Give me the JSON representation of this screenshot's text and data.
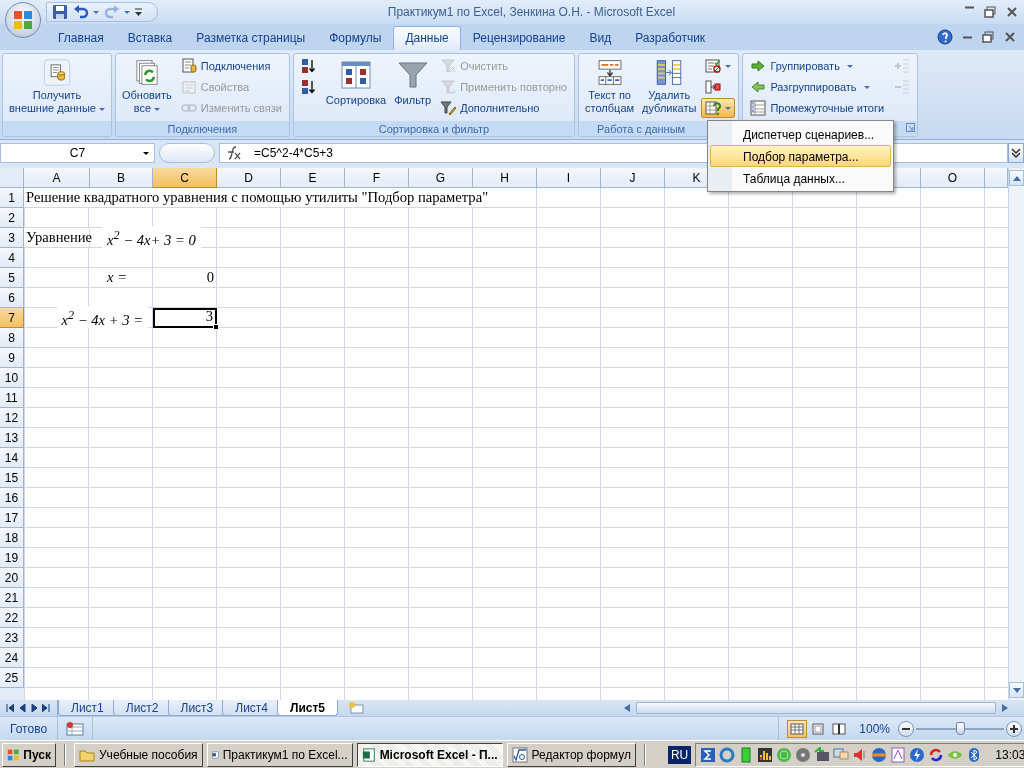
{
  "window": {
    "title": "Практикум1 по Excel, Зенкина О.Н. - Microsoft Excel",
    "quick_access": [
      {
        "disabled": false
      },
      {
        "disabled": false
      },
      {
        "disabled": true
      }
    ]
  },
  "tabs": [
    {
      "label": "Главная",
      "selected": false
    },
    {
      "label": "Вставка",
      "selected": false
    },
    {
      "label": "Разметка страницы",
      "selected": false
    },
    {
      "label": "Формулы",
      "selected": false
    },
    {
      "label": "Данные",
      "selected": true
    },
    {
      "label": "Рецензирование",
      "selected": false
    },
    {
      "label": "Вид",
      "selected": false
    },
    {
      "label": "Разработчик",
      "selected": false
    }
  ],
  "ribbon": {
    "groups": [
      {
        "columns": [
          [
            {
              "label": "Получить\nвнешние данные",
              "kind": "large",
              "dropdown": true,
              "disabled": false,
              "pressed": false
            }
          ]
        ],
        "launcher": false
      },
      {
        "label": "Подключения",
        "columns": [
          [
            {
              "label": "Обновить\nвсе",
              "kind": "large",
              "dropdown": true,
              "disabled": false,
              "pressed": false
            }
          ],
          [
            {
              "label": "Подключения",
              "kind": "small",
              "dropdown": false,
              "disabled": false,
              "pressed": false
            },
            {
              "label": "Свойства",
              "kind": "small",
              "dropdown": false,
              "disabled": true,
              "pressed": false
            },
            {
              "label": "Изменить связи",
              "kind": "small",
              "dropdown": false,
              "disabled": true,
              "pressed": false
            }
          ]
        ],
        "launcher": false
      },
      {
        "label": "Сортировка и фильтр",
        "columns": [
          [
            {
              "kind": "icon",
              "dropdown": false,
              "disabled": false,
              "pressed": false
            },
            {
              "kind": "icon",
              "dropdown": false,
              "disabled": false,
              "pressed": false
            }
          ],
          [
            {
              "label": "Сортировка",
              "kind": "large",
              "dropdown": false,
              "disabled": false,
              "pressed": false
            }
          ],
          [
            {
              "label": "Фильтр",
              "kind": "large",
              "dropdown": false,
              "disabled": false,
              "pressed": false
            }
          ],
          [
            {
              "label": "Очистить",
              "kind": "small",
              "dropdown": false,
              "disabled": true,
              "pressed": false
            },
            {
              "label": "Применить повторно",
              "kind": "small",
              "dropdown": false,
              "disabled": true,
              "pressed": false
            },
            {
              "label": "Дополнительно",
              "kind": "small",
              "dropdown": false,
              "disabled": false,
              "pressed": false
            }
          ]
        ],
        "launcher": false
      },
      {
        "label": "Работа с данным",
        "columns": [
          [
            {
              "label": "Текст по\nстолбцам",
              "kind": "large",
              "dropdown": false,
              "disabled": false,
              "pressed": false
            }
          ],
          [
            {
              "label": "Удалить\nдубликаты",
              "kind": "large",
              "dropdown": false,
              "disabled": false,
              "pressed": false
            }
          ],
          [
            {
              "kind": "icon",
              "dropdown": true,
              "disabled": false,
              "pressed": false
            },
            {
              "kind": "icon",
              "dropdown": false,
              "disabled": false,
              "pressed": false
            },
            {
              "kind": "icon",
              "dropdown": true,
              "disabled": false,
              "pressed": true
            }
          ]
        ],
        "launcher": false
      },
      {
        "columns": [
          [
            {
              "label": "Группировать",
              "kind": "small",
              "dropdown": true,
              "disabled": false,
              "pressed": false
            },
            {
              "label": "Разгруппировать",
              "kind": "small",
              "dropdown": true,
              "disabled": false,
              "pressed": false
            },
            {
              "label": "Промежуточные итоги",
              "kind": "small",
              "dropdown": false,
              "disabled": false,
              "pressed": false
            }
          ],
          [
            {
              "kind": "icon",
              "dropdown": false,
              "disabled": true,
              "pressed": false
            },
            {
              "kind": "icon",
              "dropdown": false,
              "disabled": true,
              "pressed": false
            }
          ]
        ],
        "launcher": true
      }
    ]
  },
  "menu": {
    "items": [
      {
        "label": "Диспетчер сценариев...",
        "selected": false
      },
      {
        "label": "Подбор параметра...",
        "selected": true
      },
      {
        "label": "Таблица данных...",
        "selected": false
      }
    ]
  },
  "formula_bar": {
    "name_box": "C7",
    "formula": "=C5^2-4*C5+3"
  },
  "sheet": {
    "columns": [
      {
        "label": "A"
      },
      {
        "label": "B"
      },
      {
        "label": "C"
      },
      {
        "label": "D"
      },
      {
        "label": "E"
      },
      {
        "label": "F"
      },
      {
        "label": "G"
      },
      {
        "label": "H"
      },
      {
        "label": "I"
      },
      {
        "label": "J"
      },
      {
        "label": "K"
      },
      null,
      null,
      {},
      {
        "label": "O"
      },
      {}
    ],
    "rows": [
      {
        "label": "1",
        "cells": [
          {
            "kind": "text",
            "text": "Решение квадратного уравнения с помощью утилиты \"Подбор параметра\"",
            "selected": false
          }
        ]
      },
      {
        "label": "2"
      },
      {
        "label": "3",
        "cells": [
          {
            "kind": "text",
            "text": "Уравнение",
            "selected": false
          },
          {
            "kind": "equation",
            "text": "x$^{2}$ − 4x+ 3 = 0",
            "selected": false
          }
        ]
      },
      {
        "label": "4"
      },
      {
        "label": "5",
        "cells": [
          {},
          {
            "kind": "equation",
            "text": "x  =",
            "selected": false
          },
          {
            "kind": "number",
            "text": "0",
            "selected": false
          }
        ]
      },
      {
        "label": "6"
      },
      {
        "label": "7",
        "cells": [
          {},
          {
            "kind": "expression",
            "text": "x$^{2}$ − 4x + 3 =",
            "selected": false
          },
          {
            "kind": "number",
            "text": "3",
            "selected": true
          }
        ]
      },
      {
        "label": "8"
      },
      {
        "label": "9"
      },
      {
        "label": "10"
      },
      {
        "label": "11"
      },
      {
        "label": "12"
      },
      {
        "label": "13"
      },
      {
        "label": "14"
      },
      {
        "label": "15"
      },
      {
        "label": "16"
      },
      {
        "label": "17"
      },
      {
        "label": "18"
      },
      {
        "label": "19"
      },
      {
        "label": "20"
      },
      {
        "label": "21"
      },
      {
        "label": "22"
      },
      {
        "label": "23"
      },
      {
        "label": "24"
      },
      {
        "label": "25"
      }
    ]
  },
  "sheet_tabs": [
    {
      "label": "Лист1",
      "selected": false
    },
    {
      "label": "Лист2",
      "selected": false
    },
    {
      "label": "Лист3",
      "selected": false
    },
    {
      "label": "Лист4",
      "selected": false
    },
    {
      "label": "Лист5",
      "selected": true
    }
  ],
  "status_bar": {
    "text": "Готово",
    "views": [
      {
        "selected": true
      },
      {
        "selected": false
      },
      {
        "selected": false
      }
    ],
    "zoom": "100%",
    "level": 0.5
  },
  "taskbar": {
    "start": "Пуск",
    "items": [
      {
        "label": "Учебные пособия",
        "selected": false
      },
      {
        "label": "Практикум1 по Excel...",
        "selected": false
      },
      {
        "label": "Microsoft Excel - П...",
        "selected": true
      },
      {
        "label": "Редактор формул",
        "selected": false
      }
    ],
    "language": "RU",
    "clock": "13:03"
  }
}
